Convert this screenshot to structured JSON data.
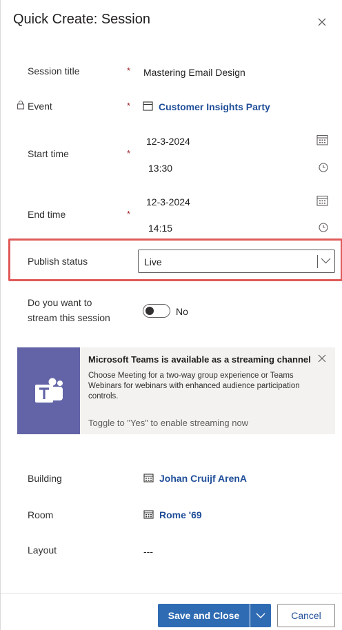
{
  "header": {
    "title": "Quick Create: Session"
  },
  "form": {
    "required_mark": "*",
    "session_title": {
      "label": "Session title",
      "value": "Mastering Email Design"
    },
    "event": {
      "label": "Event",
      "value": "Customer Insights Party"
    },
    "start_time": {
      "label": "Start time",
      "date": "12-3-2024",
      "time": "13:30"
    },
    "end_time": {
      "label": "End time",
      "date": "12-3-2024",
      "time": "14:15"
    },
    "publish_status": {
      "label": "Publish status",
      "value": "Live"
    },
    "stream": {
      "label_line1": "Do you want to",
      "label_line2": "stream this session",
      "value": "No"
    },
    "building": {
      "label": "Building",
      "value": "Johan Cruijf ArenA"
    },
    "room": {
      "label": "Room",
      "value": "Rome '69"
    },
    "layout": {
      "label": "Layout",
      "value": "---"
    }
  },
  "banner": {
    "title": "Microsoft Teams is available as a streaming channel",
    "body": "Choose Meeting for a two-way group experience or Teams Webinars for webinars with enhanced audience participation controls.",
    "footer": "Toggle to \"Yes\" to enable streaming now"
  },
  "footer": {
    "save_label": "Save and Close",
    "cancel_label": "Cancel"
  },
  "colors": {
    "accent": "#2f6bb3",
    "link": "#1f4e99",
    "required": "#a4262c",
    "teams": "#6264a7",
    "highlight": "#e05a5a"
  }
}
